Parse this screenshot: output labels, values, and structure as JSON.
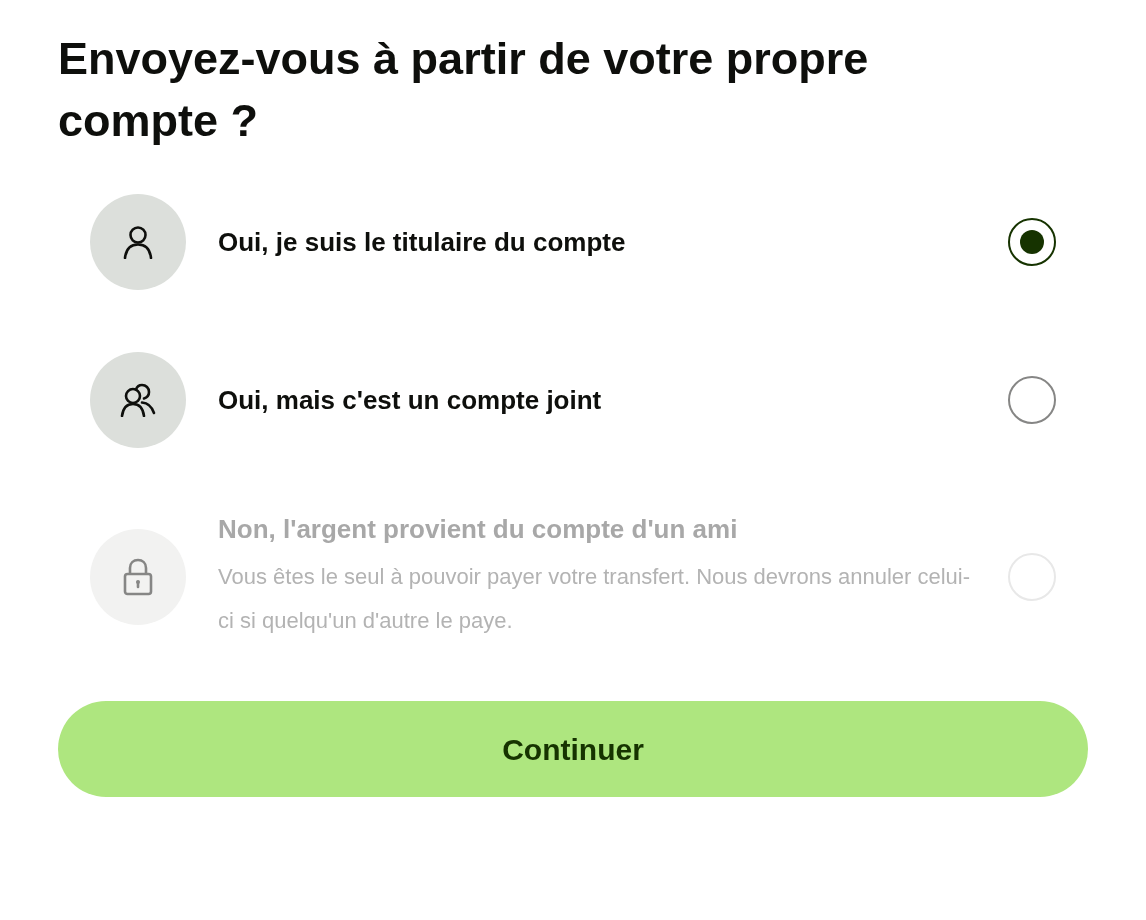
{
  "title": "Envoyez-vous à partir de votre propre compte ?",
  "options": [
    {
      "kind": "person",
      "label": "Oui, je suis le titulaire du compte",
      "selected": true,
      "disabled": false
    },
    {
      "kind": "people",
      "label": "Oui, mais c'est un compte joint",
      "selected": false,
      "disabled": false
    },
    {
      "kind": "lock",
      "label": "Non, l'argent provient du compte d'un ami",
      "description": "Vous êtes le seul à pouvoir payer votre transfert. Nous devrons annuler celui-ci si quelqu'un d'autre le paye.",
      "selected": false,
      "disabled": true
    }
  ],
  "button": {
    "label": "Continuer"
  }
}
